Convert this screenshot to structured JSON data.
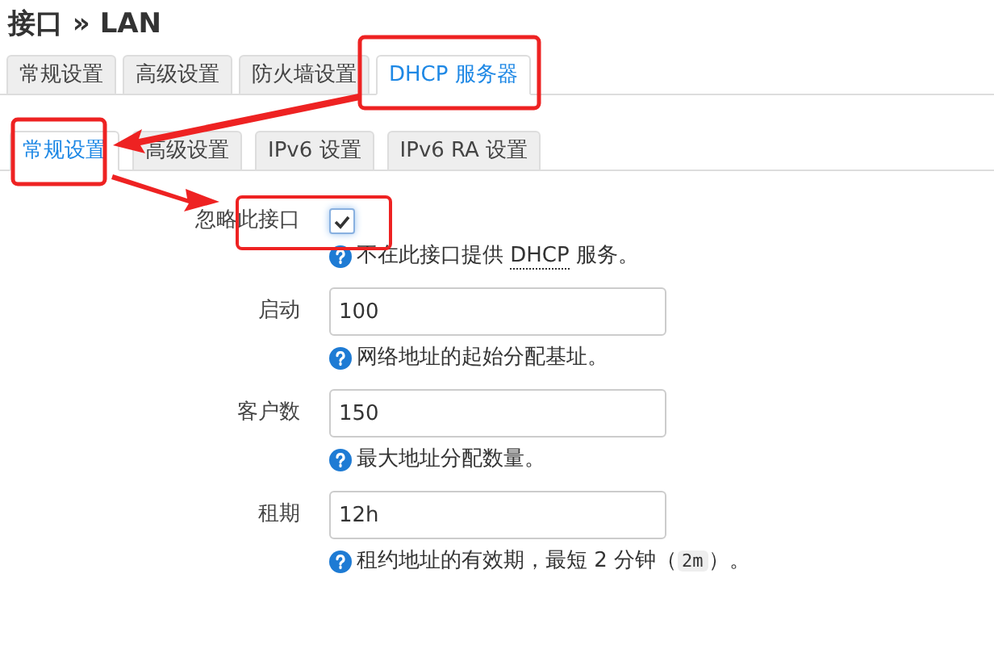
{
  "title": "接口 » LAN",
  "tabs": [
    {
      "label": "常规设置",
      "selected": false
    },
    {
      "label": "高级设置",
      "selected": false
    },
    {
      "label": "防火墙设置",
      "selected": false
    },
    {
      "label": "DHCP 服务器",
      "selected": true
    }
  ],
  "subtabs": [
    {
      "label": "常规设置",
      "selected": true
    },
    {
      "label": "高级设置",
      "selected": false
    },
    {
      "label": "IPv6 设置",
      "selected": false
    },
    {
      "label": "IPv6 RA 设置",
      "selected": false
    }
  ],
  "fields": [
    {
      "kind": "checkbox",
      "label": "忽略此接口",
      "checked": true,
      "description": [
        {
          "kind": "text",
          "text": "不在此接口提供 "
        },
        {
          "kind": "abbr",
          "text": "DHCP"
        },
        {
          "kind": "text",
          "text": " 服务。"
        }
      ]
    },
    {
      "kind": "input",
      "label": "启动",
      "value": "100",
      "description": [
        {
          "kind": "text",
          "text": "网络地址的起始分配基址。"
        }
      ]
    },
    {
      "kind": "input",
      "label": "客户数",
      "value": "150",
      "description": [
        {
          "kind": "text",
          "text": "最大地址分配数量。"
        }
      ]
    },
    {
      "kind": "input",
      "label": "租期",
      "value": "12h",
      "description": [
        {
          "kind": "text",
          "text": "租约地址的有效期，最短 2 分钟（"
        },
        {
          "kind": "code",
          "text": "2m"
        },
        {
          "kind": "text",
          "text": "）。"
        }
      ]
    }
  ]
}
